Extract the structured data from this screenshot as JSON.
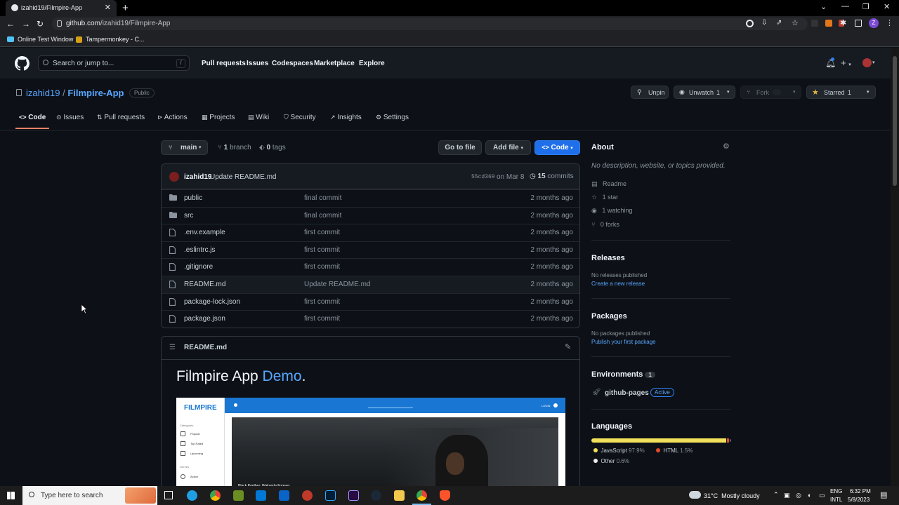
{
  "browser": {
    "tab_title": "izahid19/Filmpire-App",
    "url_host": "github.com",
    "url_path": "/izahid19/Filmpire-App",
    "bookmarks": [
      "Online Test Window",
      "Tampermonkey - C..."
    ],
    "profile_initial": "Z"
  },
  "github_header": {
    "search_placeholder": "Search or jump to...",
    "search_key": "/",
    "nav": [
      "Pull requests",
      "Issues",
      "Codespaces",
      "Marketplace",
      "Explore"
    ]
  },
  "repo": {
    "owner": "izahid19",
    "separator": "/",
    "name": "Filmpire-App",
    "visibility": "Public",
    "actions": {
      "unpin": "Unpin",
      "unwatch": "Unwatch",
      "unwatch_count": "1",
      "fork": "Fork",
      "starred": "Starred",
      "star_count": "1"
    },
    "tabs": [
      "Code",
      "Issues",
      "Pull requests",
      "Actions",
      "Projects",
      "Wiki",
      "Security",
      "Insights",
      "Settings"
    ]
  },
  "code_toolbar": {
    "branch": "main",
    "branches_count": "1",
    "branches_label": "branch",
    "tags_count": "0",
    "tags_label": "tags",
    "go_to_file": "Go to file",
    "add_file": "Add file",
    "code": "Code"
  },
  "latest_commit": {
    "author": "izahid19",
    "message": "Update README.md",
    "sha": "55cd369",
    "date": "on Mar 8",
    "commits_count": "15",
    "commits_label": "commits"
  },
  "files": [
    {
      "name": "public",
      "type": "dir",
      "message": "final commit",
      "age": "2 months ago"
    },
    {
      "name": "src",
      "type": "dir",
      "message": "final commit",
      "age": "2 months ago"
    },
    {
      "name": ".env.example",
      "type": "file",
      "message": "first commit",
      "age": "2 months ago"
    },
    {
      "name": ".eslintrc.js",
      "type": "file",
      "message": "first commit",
      "age": "2 months ago"
    },
    {
      "name": ".gitignore",
      "type": "file",
      "message": "first commit",
      "age": "2 months ago"
    },
    {
      "name": "README.md",
      "type": "file",
      "message": "Update README.md",
      "age": "2 months ago"
    },
    {
      "name": "package-lock.json",
      "type": "file",
      "message": "first commit",
      "age": "2 months ago"
    },
    {
      "name": "package.json",
      "type": "file",
      "message": "first commit",
      "age": "2 months ago"
    }
  ],
  "readme": {
    "filename": "README.md",
    "heading_main": "Filmpire App ",
    "heading_link": "Demo",
    "heading_end": ".",
    "preview": {
      "logo": "FILMPIRE",
      "section": "Categories",
      "items": [
        "Popular",
        "Top Rated",
        "Upcoming"
      ],
      "section2": "Genres",
      "genre": "Action",
      "login": "LOGIN",
      "caption": "Black Panther: Wakanda Forever"
    }
  },
  "about": {
    "title": "About",
    "description": "No description, website, or topics provided.",
    "items": [
      "Readme",
      "1 star",
      "1 watching",
      "0 forks"
    ]
  },
  "releases": {
    "title": "Releases",
    "none": "No releases published",
    "link": "Create a new release"
  },
  "packages": {
    "title": "Packages",
    "none": "No packages published",
    "link": "Publish your first package"
  },
  "environments": {
    "title": "Environments",
    "count": "1",
    "name": "github-pages",
    "status": "Active"
  },
  "languages": {
    "title": "Languages",
    "items": [
      {
        "name": "JavaScript",
        "percent": "97.9%",
        "value": 97.9,
        "color": "#f1e05a"
      },
      {
        "name": "HTML",
        "percent": "1.5%",
        "value": 1.5,
        "color": "#e34c26"
      },
      {
        "name": "Other",
        "percent": "0.6%",
        "value": 0.6,
        "color": "#ededed"
      }
    ]
  },
  "taskbar": {
    "search": "Type here to search",
    "weather": "31°C  Mostly cloudy",
    "lang1": "ENG",
    "lang2": "INTL",
    "time": "6:32 PM",
    "date": "5/8/2023"
  },
  "colors": {
    "bg": "#0d1117",
    "header_bg": "#161b22",
    "link": "#58a6ff",
    "primary_btn": "#1f6feb",
    "active_tab_underline": "#f78166",
    "active_badge": "#2f81f7"
  }
}
